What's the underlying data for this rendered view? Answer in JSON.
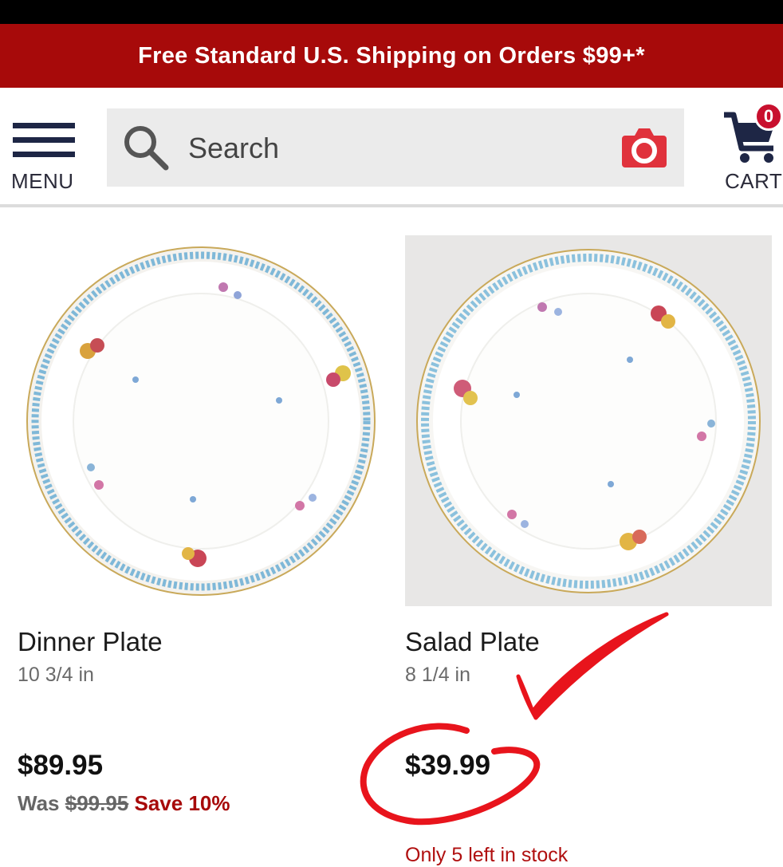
{
  "promo": {
    "text": "Free Standard U.S. Shipping on Orders $99+*"
  },
  "header": {
    "menu_label": "MENU",
    "search_placeholder": "Search",
    "cart_label": "CART",
    "cart_count": "0"
  },
  "products": [
    {
      "name": "Dinner Plate",
      "size": "10 3/4 in",
      "price": "$89.95",
      "was_label": "Was",
      "was_price": "$99.95",
      "save_text": "Save 10%"
    },
    {
      "name": "Salad Plate",
      "size": "8 1/4 in",
      "price": "$39.99",
      "stock_note": "Only 5 left in stock"
    }
  ],
  "colors": {
    "promo_red": "#a70a0a",
    "navy": "#1e2645",
    "camera_red": "#e0323c",
    "annotation_red": "#e8141c"
  }
}
